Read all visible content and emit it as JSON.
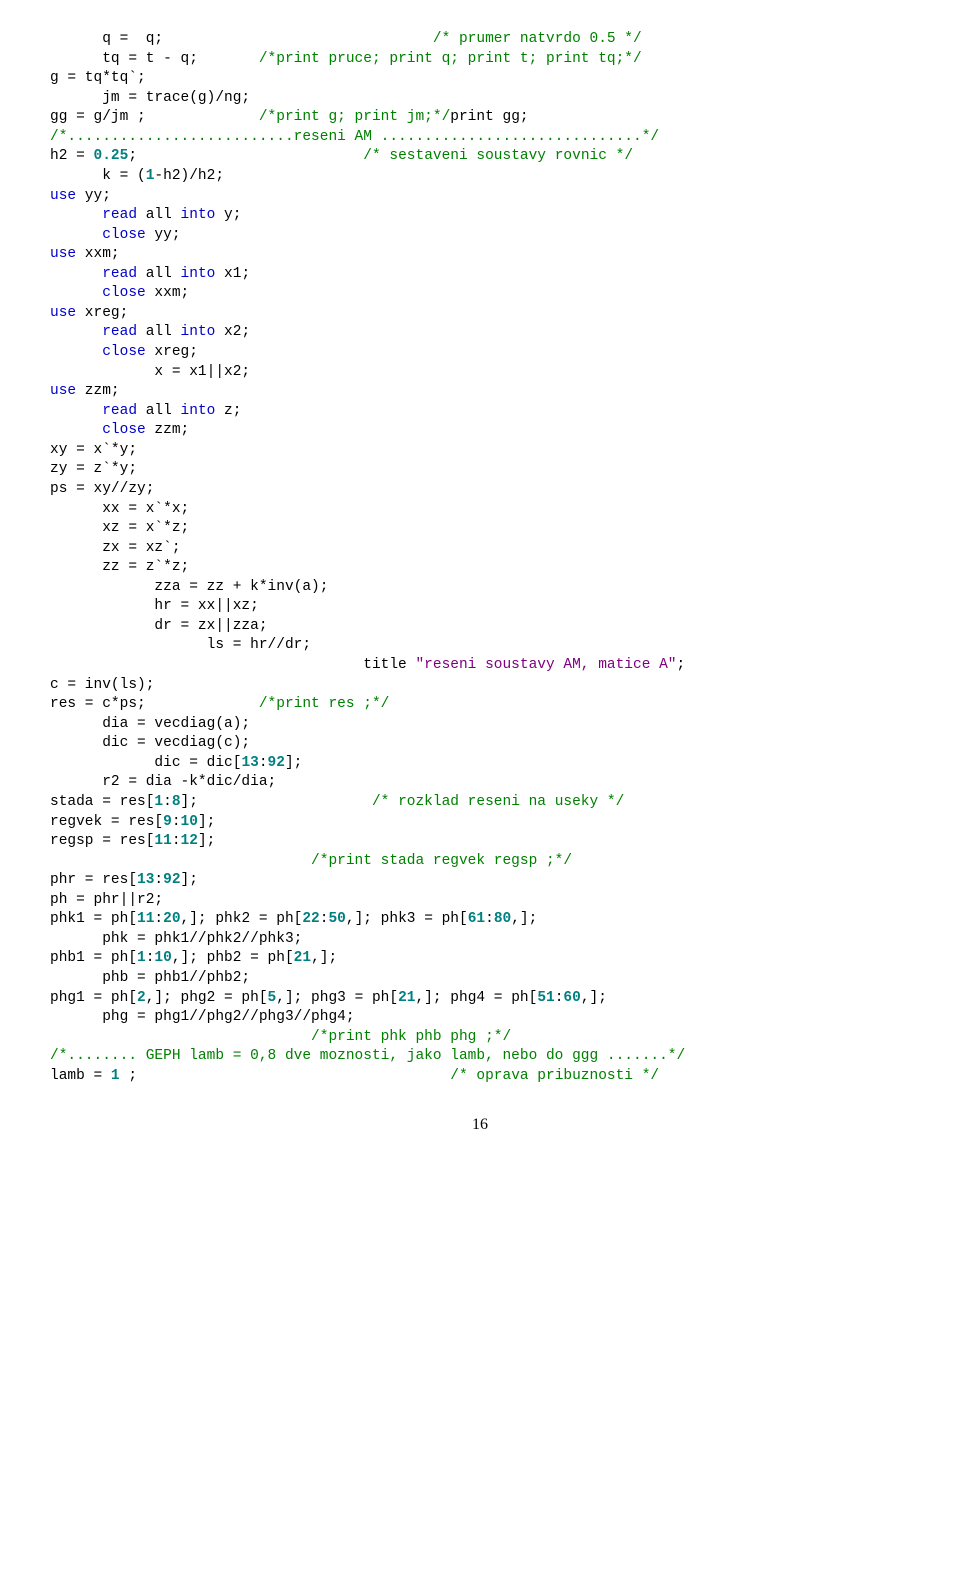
{
  "code_lines": [
    {
      "segs": [
        {
          "t": "      q =  q;                               ",
          "c": 0
        },
        {
          "t": "/* prumer natvrdo 0.5 */",
          "c": 3
        }
      ]
    },
    {
      "segs": [
        {
          "t": "      tq = t - q;       ",
          "c": 0
        },
        {
          "t": "/*print pruce; print q; print t; print tq;*/",
          "c": 3
        }
      ]
    },
    {
      "segs": [
        {
          "t": "g = tq*tq`;",
          "c": 0
        }
      ]
    },
    {
      "segs": [
        {
          "t": "      jm = trace(g)/ng;",
          "c": 0
        }
      ]
    },
    {
      "segs": [
        {
          "t": "gg = g/jm ;             ",
          "c": 0
        },
        {
          "t": "/*print g; print jm;*/",
          "c": 3
        },
        {
          "t": "print gg;",
          "c": 0
        }
      ]
    },
    {
      "segs": [
        {
          "t": "/*..........................reseni AM ..............................*/",
          "c": 3
        }
      ]
    },
    {
      "segs": [
        {
          "t": "h2 = ",
          "c": 0
        },
        {
          "t": "0.25",
          "c": 2
        },
        {
          "t": ";                          ",
          "c": 0
        },
        {
          "t": "/* sestaveni soustavy rovnic */",
          "c": 3
        }
      ]
    },
    {
      "segs": [
        {
          "t": "      k = (",
          "c": 0
        },
        {
          "t": "1",
          "c": 2
        },
        {
          "t": "-h2)/h2;",
          "c": 0
        }
      ]
    },
    {
      "segs": [
        {
          "t": "use",
          "c": 1
        },
        {
          "t": " yy;",
          "c": 0
        }
      ]
    },
    {
      "segs": [
        {
          "t": "      ",
          "c": 0
        },
        {
          "t": "read",
          "c": 1
        },
        {
          "t": " all ",
          "c": 0
        },
        {
          "t": "into",
          "c": 1
        },
        {
          "t": " y;",
          "c": 0
        }
      ]
    },
    {
      "segs": [
        {
          "t": "      ",
          "c": 0
        },
        {
          "t": "close",
          "c": 1
        },
        {
          "t": " yy;",
          "c": 0
        }
      ]
    },
    {
      "segs": [
        {
          "t": "use",
          "c": 1
        },
        {
          "t": " xxm;",
          "c": 0
        }
      ]
    },
    {
      "segs": [
        {
          "t": "      ",
          "c": 0
        },
        {
          "t": "read",
          "c": 1
        },
        {
          "t": " all ",
          "c": 0
        },
        {
          "t": "into",
          "c": 1
        },
        {
          "t": " x1;",
          "c": 0
        }
      ]
    },
    {
      "segs": [
        {
          "t": "      ",
          "c": 0
        },
        {
          "t": "close",
          "c": 1
        },
        {
          "t": " xxm;",
          "c": 0
        }
      ]
    },
    {
      "segs": [
        {
          "t": "use",
          "c": 1
        },
        {
          "t": " xreg;",
          "c": 0
        }
      ]
    },
    {
      "segs": [
        {
          "t": "      ",
          "c": 0
        },
        {
          "t": "read",
          "c": 1
        },
        {
          "t": " all ",
          "c": 0
        },
        {
          "t": "into",
          "c": 1
        },
        {
          "t": " x2;",
          "c": 0
        }
      ]
    },
    {
      "segs": [
        {
          "t": "      ",
          "c": 0
        },
        {
          "t": "close",
          "c": 1
        },
        {
          "t": " xreg;",
          "c": 0
        }
      ]
    },
    {
      "segs": [
        {
          "t": "            x = x1||x2;",
          "c": 0
        }
      ]
    },
    {
      "segs": [
        {
          "t": "use",
          "c": 1
        },
        {
          "t": " zzm;",
          "c": 0
        }
      ]
    },
    {
      "segs": [
        {
          "t": "      ",
          "c": 0
        },
        {
          "t": "read",
          "c": 1
        },
        {
          "t": " all ",
          "c": 0
        },
        {
          "t": "into",
          "c": 1
        },
        {
          "t": " z;",
          "c": 0
        }
      ]
    },
    {
      "segs": [
        {
          "t": "      ",
          "c": 0
        },
        {
          "t": "close",
          "c": 1
        },
        {
          "t": " zzm;",
          "c": 0
        }
      ]
    },
    {
      "segs": [
        {
          "t": "xy = x`*y;",
          "c": 0
        }
      ]
    },
    {
      "segs": [
        {
          "t": "zy = z`*y;",
          "c": 0
        }
      ]
    },
    {
      "segs": [
        {
          "t": "ps = xy//zy;",
          "c": 0
        }
      ]
    },
    {
      "segs": [
        {
          "t": "      xx = x`*x;",
          "c": 0
        }
      ]
    },
    {
      "segs": [
        {
          "t": "      xz = x`*z;",
          "c": 0
        }
      ]
    },
    {
      "segs": [
        {
          "t": "      zx = xz`;",
          "c": 0
        }
      ]
    },
    {
      "segs": [
        {
          "t": "      zz = z`*z;",
          "c": 0
        }
      ]
    },
    {
      "segs": [
        {
          "t": "            zza = zz + k*inv(a);",
          "c": 0
        }
      ]
    },
    {
      "segs": [
        {
          "t": "            hr = xx||xz;",
          "c": 0
        }
      ]
    },
    {
      "segs": [
        {
          "t": "            dr = zx||zza;",
          "c": 0
        }
      ]
    },
    {
      "segs": [
        {
          "t": "                  ls = hr//dr;",
          "c": 0
        }
      ]
    },
    {
      "segs": [
        {
          "t": "                                    title ",
          "c": 0
        },
        {
          "t": "\"reseni soustavy AM, matice A\"",
          "c": 4
        },
        {
          "t": ";",
          "c": 0
        }
      ]
    },
    {
      "segs": [
        {
          "t": "c = inv(ls);",
          "c": 0
        }
      ]
    },
    {
      "segs": [
        {
          "t": "res = c*ps;             ",
          "c": 0
        },
        {
          "t": "/*print res ;*/",
          "c": 3
        }
      ]
    },
    {
      "segs": [
        {
          "t": "      dia = vecdiag(a);",
          "c": 0
        }
      ]
    },
    {
      "segs": [
        {
          "t": "      dic = vecdiag(c);",
          "c": 0
        }
      ]
    },
    {
      "segs": [
        {
          "t": "            dic = dic[",
          "c": 0
        },
        {
          "t": "13",
          "c": 2
        },
        {
          "t": ":",
          "c": 0
        },
        {
          "t": "92",
          "c": 2
        },
        {
          "t": "];",
          "c": 0
        }
      ]
    },
    {
      "segs": [
        {
          "t": "      r2 = dia -k*dic/dia;",
          "c": 0
        }
      ]
    },
    {
      "segs": [
        {
          "t": "stada = res[",
          "c": 0
        },
        {
          "t": "1",
          "c": 2
        },
        {
          "t": ":",
          "c": 0
        },
        {
          "t": "8",
          "c": 2
        },
        {
          "t": "];                    ",
          "c": 0
        },
        {
          "t": "/* rozklad reseni na useky */",
          "c": 3
        }
      ]
    },
    {
      "segs": [
        {
          "t": "regvek = res[",
          "c": 0
        },
        {
          "t": "9",
          "c": 2
        },
        {
          "t": ":",
          "c": 0
        },
        {
          "t": "10",
          "c": 2
        },
        {
          "t": "];",
          "c": 0
        }
      ]
    },
    {
      "segs": [
        {
          "t": "regsp = res[",
          "c": 0
        },
        {
          "t": "11",
          "c": 2
        },
        {
          "t": ":",
          "c": 0
        },
        {
          "t": "12",
          "c": 2
        },
        {
          "t": "];",
          "c": 0
        }
      ]
    },
    {
      "segs": [
        {
          "t": "                              ",
          "c": 0
        },
        {
          "t": "/*print stada regvek regsp ;*/",
          "c": 3
        }
      ]
    },
    {
      "segs": [
        {
          "t": "phr = res[",
          "c": 0
        },
        {
          "t": "13",
          "c": 2
        },
        {
          "t": ":",
          "c": 0
        },
        {
          "t": "92",
          "c": 2
        },
        {
          "t": "];",
          "c": 0
        }
      ]
    },
    {
      "segs": [
        {
          "t": "ph = phr||r2;",
          "c": 0
        }
      ]
    },
    {
      "segs": [
        {
          "t": "phk1 = ph[",
          "c": 0
        },
        {
          "t": "11",
          "c": 2
        },
        {
          "t": ":",
          "c": 0
        },
        {
          "t": "20",
          "c": 2
        },
        {
          "t": ",]; phk2 = ph[",
          "c": 0
        },
        {
          "t": "22",
          "c": 2
        },
        {
          "t": ":",
          "c": 0
        },
        {
          "t": "50",
          "c": 2
        },
        {
          "t": ",]; phk3 = ph[",
          "c": 0
        },
        {
          "t": "61",
          "c": 2
        },
        {
          "t": ":",
          "c": 0
        },
        {
          "t": "80",
          "c": 2
        },
        {
          "t": ",];",
          "c": 0
        }
      ]
    },
    {
      "segs": [
        {
          "t": "      phk = phk1//phk2//phk3;",
          "c": 0
        }
      ]
    },
    {
      "segs": [
        {
          "t": "phb1 = ph[",
          "c": 0
        },
        {
          "t": "1",
          "c": 2
        },
        {
          "t": ":",
          "c": 0
        },
        {
          "t": "10",
          "c": 2
        },
        {
          "t": ",]; phb2 = ph[",
          "c": 0
        },
        {
          "t": "21",
          "c": 2
        },
        {
          "t": ",];",
          "c": 0
        }
      ]
    },
    {
      "segs": [
        {
          "t": "      phb = phb1//phb2;",
          "c": 0
        }
      ]
    },
    {
      "segs": [
        {
          "t": "phg1 = ph[",
          "c": 0
        },
        {
          "t": "2",
          "c": 2
        },
        {
          "t": ",]; phg2 = ph[",
          "c": 0
        },
        {
          "t": "5",
          "c": 2
        },
        {
          "t": ",]; phg3 = ph[",
          "c": 0
        },
        {
          "t": "21",
          "c": 2
        },
        {
          "t": ",]; phg4 = ph[",
          "c": 0
        },
        {
          "t": "51",
          "c": 2
        },
        {
          "t": ":",
          "c": 0
        },
        {
          "t": "60",
          "c": 2
        },
        {
          "t": ",];",
          "c": 0
        }
      ]
    },
    {
      "segs": [
        {
          "t": "      phg = phg1//phg2//phg3//phg4;",
          "c": 0
        }
      ]
    },
    {
      "segs": [
        {
          "t": "                              ",
          "c": 0
        },
        {
          "t": "/*print phk phb phg ;*/",
          "c": 3
        }
      ]
    },
    {
      "segs": [
        {
          "t": "/*........ GEPH lamb = 0,8 dve moznosti, jako lamb, nebo do ggg .......*/",
          "c": 3
        }
      ]
    },
    {
      "segs": [
        {
          "t": "lamb = ",
          "c": 0
        },
        {
          "t": "1",
          "c": 2
        },
        {
          "t": " ;                                    ",
          "c": 0
        },
        {
          "t": "/* oprava pribuznosti */",
          "c": 3
        }
      ]
    }
  ],
  "page_number": "16"
}
